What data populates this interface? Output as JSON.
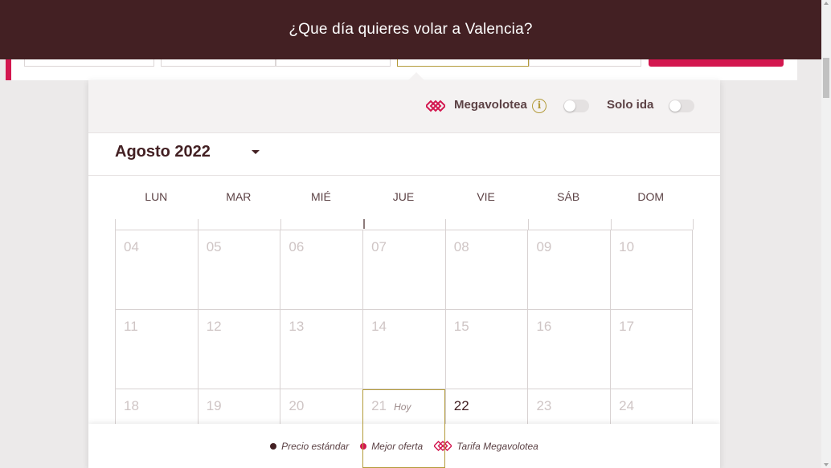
{
  "header": {
    "title": "¿Que día quieres volar a Valencia?"
  },
  "options": {
    "megavolotea_label": "Megavolotea",
    "info_icon": "info-icon",
    "solo_ida_label": "Solo ida",
    "megavolotea_toggle": false,
    "solo_ida_toggle": false
  },
  "month": {
    "label": "Agosto 2022"
  },
  "weekdays": [
    "LUN",
    "MAR",
    "MIÉ",
    "JUE",
    "VIE",
    "SÁB",
    "DOM"
  ],
  "weeks": [
    [
      "04",
      "05",
      "06",
      "07",
      "08",
      "09",
      "10"
    ],
    [
      "11",
      "12",
      "13",
      "14",
      "15",
      "16",
      "17"
    ],
    [
      "18",
      "19",
      "20",
      "21",
      "22",
      "23",
      "24"
    ]
  ],
  "today": {
    "label": "Hoy"
  },
  "legend": {
    "standard": "Precio estándar",
    "best": "Mejor oferta",
    "mega": "Tarifa Megavolotea"
  },
  "colors": {
    "brand_dark": "#432023",
    "accent_pink": "#d3174f",
    "accent_gold": "#b39b3a",
    "standard_dot": "#432023",
    "best_dot": "#d3174f"
  }
}
